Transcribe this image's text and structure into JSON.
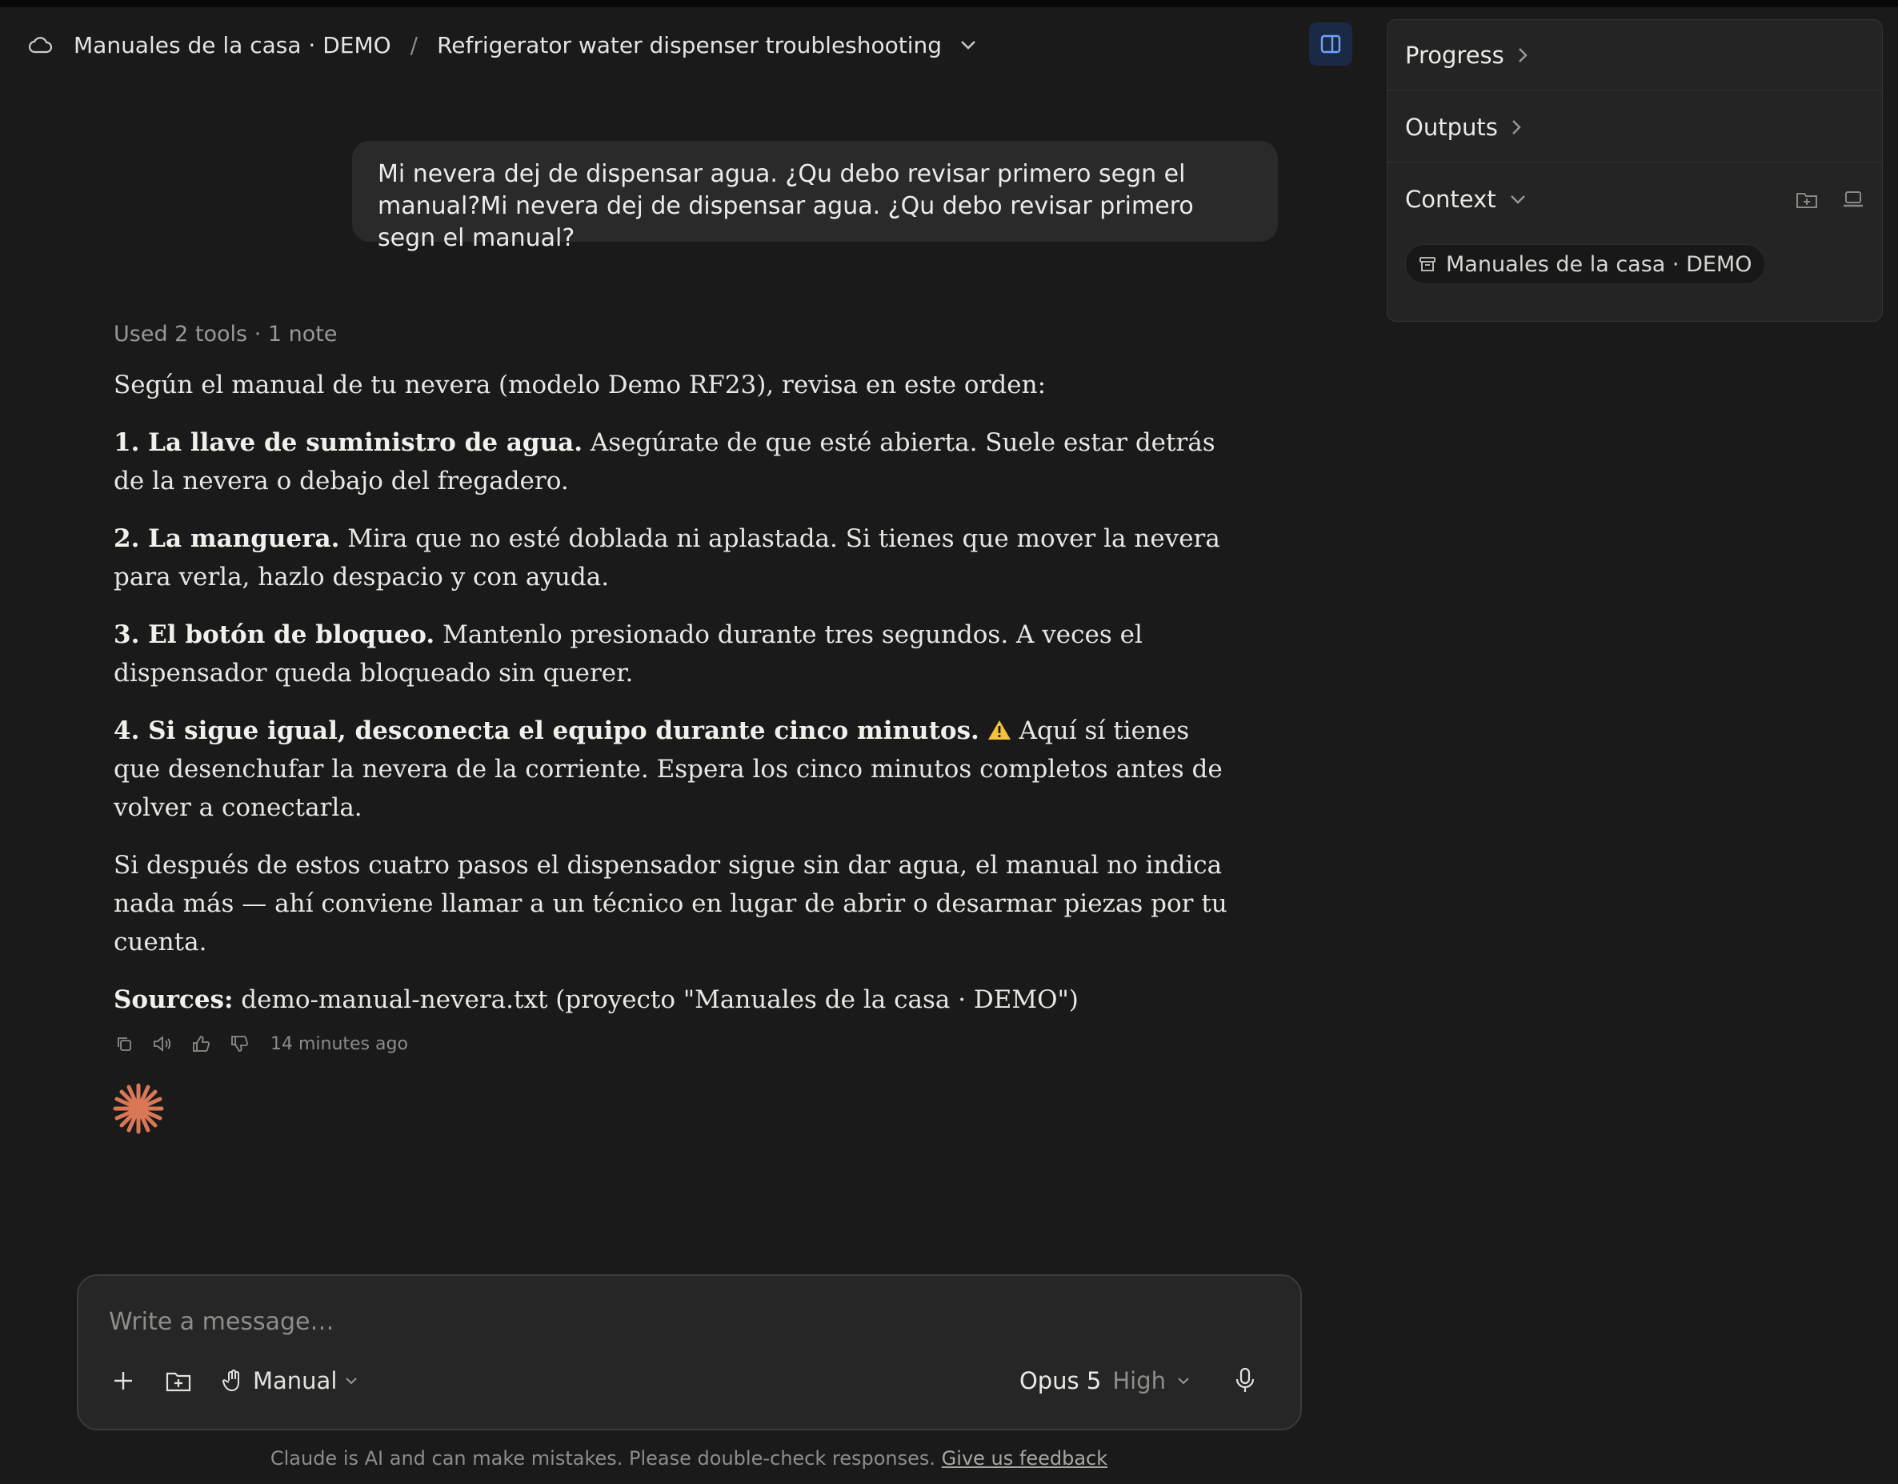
{
  "header": {
    "project": "Manuales de la casa · DEMO",
    "separator": "/",
    "chat_title": "Refrigerator water dispenser troubleshooting"
  },
  "sidebar": {
    "progress_label": "Progress",
    "outputs_label": "Outputs",
    "context_label": "Context",
    "context_chip": "Manuales de la casa · DEMO"
  },
  "user_message": "Mi nevera dej de dispensar agua. ¿Qu debo revisar primero segn el manual?Mi nevera dej de dispensar agua. ¿Qu debo revisar primero segn el manual?",
  "assistant": {
    "tools_used": "Used 2 tools · 1 note",
    "intro": "Según el manual de tu nevera (modelo Demo RF23), revisa en este orden:",
    "steps": [
      {
        "title": "1. La llave de suministro de agua.",
        "text": " Asegúrate de que esté abierta. Suele estar detrás de la nevera o debajo del fregadero."
      },
      {
        "title": "2. La manguera.",
        "text": " Mira que no esté doblada ni aplastada. Si tienes que mover la nevera para verla, hazlo despacio y con ayuda."
      },
      {
        "title": "3. El botón de bloqueo.",
        "text": " Mantenlo presionado durante tres segundos. A veces el dispensador queda bloqueado sin querer."
      },
      {
        "title": "4. Si sigue igual, desconecta el equipo durante cinco minutos.",
        "text": " Aquí sí tienes que desenchufar la nevera de la corriente. Espera los cinco minutos completos antes de volver a conectarla."
      }
    ],
    "closing": "Si después de estos cuatro pasos el dispensador sigue sin dar agua, el manual no indica nada más — ahí conviene llamar a un técnico en lugar de abrir o desarmar piezas por tu cuenta.",
    "sources_label": "Sources:",
    "sources_text": " demo-manual-nevera.txt (proyecto \"Manuales de la casa · DEMO\")",
    "timestamp": "14 minutes ago"
  },
  "composer": {
    "placeholder": "Write a message…",
    "mode_label": "Manual",
    "model": "Opus 5",
    "effort": "High"
  },
  "disclaimer": {
    "text": "Claude is AI and can make mistakes. Please double-check responses. ",
    "feedback_link": "Give us feedback"
  },
  "colors": {
    "background": "#1a1a1a",
    "panel": "#242424",
    "user_bubble": "#2a2a2a",
    "accent_spark": "#d97757",
    "toggle_active": "#1b2a44"
  }
}
